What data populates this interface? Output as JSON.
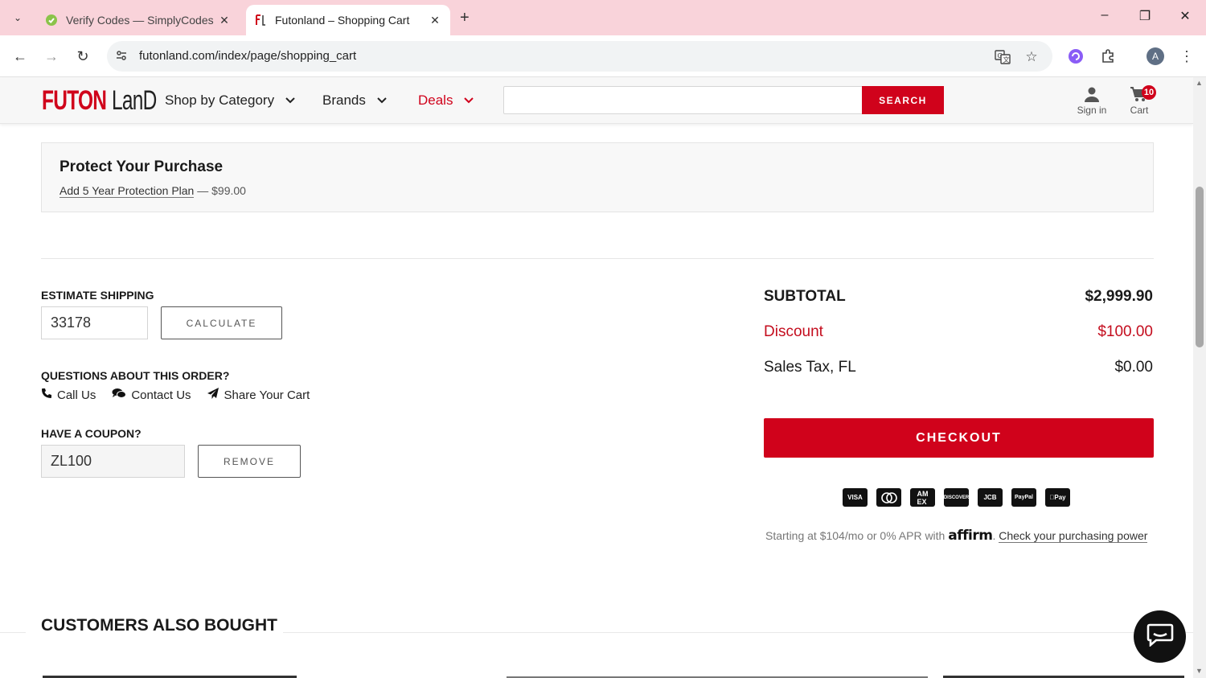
{
  "browser": {
    "tabs": [
      {
        "title": "Verify Codes — SimplyCodes",
        "favicon": "simplycodes-icon"
      },
      {
        "title": "Futonland – Shopping Cart",
        "favicon": "futonland-icon"
      }
    ],
    "url": "futonland.com/index/page/shopping_cart",
    "profile_initial": "A"
  },
  "header": {
    "logo_part1": "FUTON",
    "logo_part2": "LanD",
    "nav": [
      "Shop by Category",
      "Brands",
      "Deals"
    ],
    "search_placeholder": "",
    "search_button": "SEARCH",
    "sign_in": "Sign in",
    "cart": "Cart",
    "cart_count": "10"
  },
  "protect": {
    "title": "Protect Your Purchase",
    "plan_link": "Add 5 Year Protection Plan",
    "plan_price": "— $99.00"
  },
  "shipping": {
    "label": "ESTIMATE SHIPPING",
    "zip": "33178",
    "calculate_button": "CALCULATE"
  },
  "questions": {
    "label": "QUESTIONS ABOUT THIS ORDER?",
    "links": [
      "Call Us",
      "Contact Us",
      "Share Your Cart"
    ]
  },
  "coupon": {
    "label": "HAVE A COUPON?",
    "code": "ZL100",
    "remove_button": "REMOVE"
  },
  "summary": {
    "subtotal_label": "SUBTOTAL",
    "subtotal_value": "$2,999.90",
    "discount_label": "Discount",
    "discount_value": "$100.00",
    "tax_label": "Sales Tax, FL",
    "tax_value": "$0.00",
    "checkout_button": "CHECKOUT"
  },
  "payment_methods": [
    "VISA",
    "MC",
    "AMEX",
    "DISCOVER",
    "JCB",
    "PayPal",
    "Pay"
  ],
  "affirm": {
    "text": "Starting at $104/mo or 0% APR with",
    "logo": "affirm",
    "link": "Check your purchasing power"
  },
  "also_bought": {
    "title": "CUSTOMERS ALSO BOUGHT"
  },
  "colors": {
    "brand_red": "#d0021b",
    "tabbar_pink": "#f9d3da"
  }
}
